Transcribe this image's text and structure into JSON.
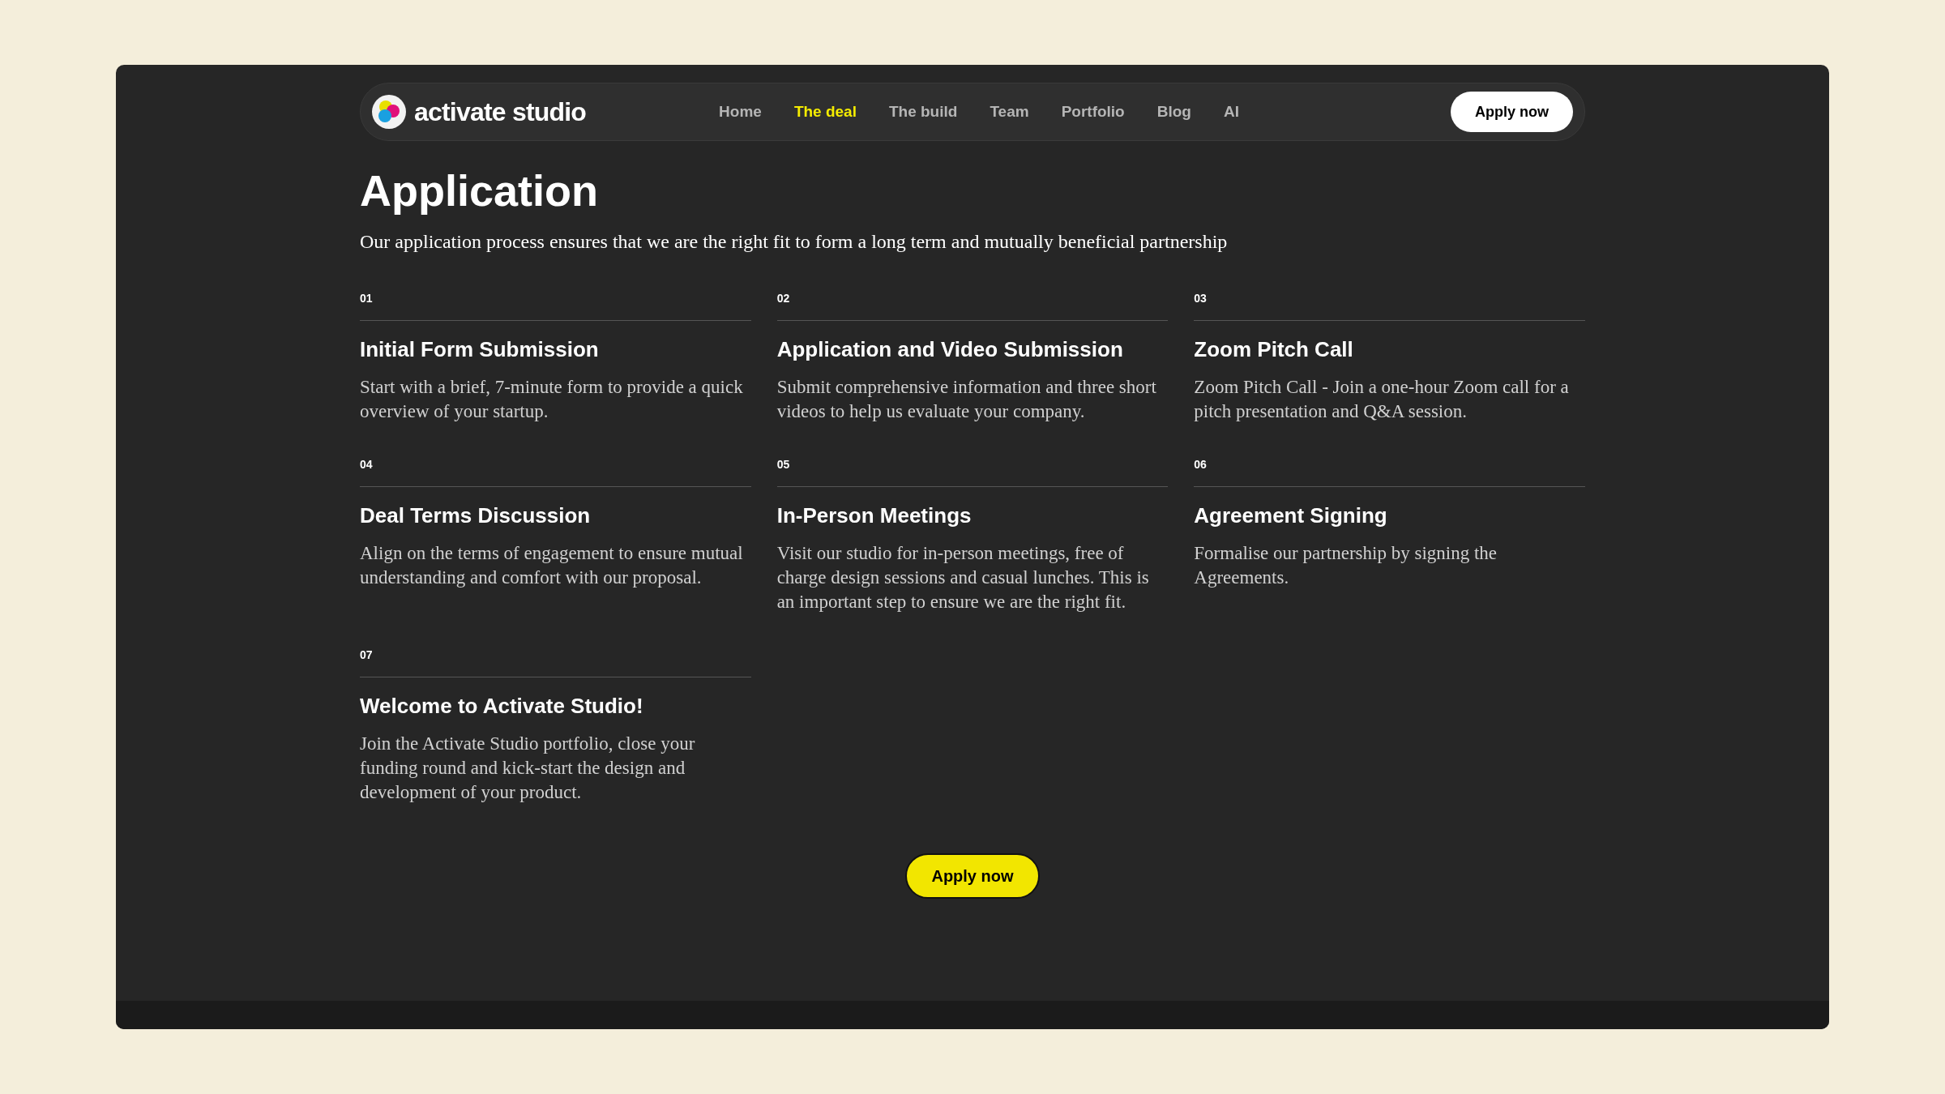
{
  "nav": {
    "logo": "activate studio",
    "links": [
      {
        "label": "Home",
        "selected": false
      },
      {
        "label": "The deal",
        "selected": true
      },
      {
        "label": "The build",
        "selected": false
      },
      {
        "label": "Team",
        "selected": false
      },
      {
        "label": "Portfolio",
        "selected": false
      },
      {
        "label": "Blog",
        "selected": false
      },
      {
        "label": "AI",
        "selected": false
      }
    ],
    "cta": "Apply now"
  },
  "heading": "Application",
  "intro": "Our application process ensures that we are the right fit to form a long term and mutually beneficial partnership",
  "steps": [
    {
      "number": "01",
      "title": "Initial Form Submission",
      "text": "Start with a brief, 7-minute form to provide a quick overview of your startup."
    },
    {
      "number": "02",
      "title": "Application and Video Submission",
      "text": "Submit comprehensive information and three short videos to help us evaluate your company."
    },
    {
      "number": "03",
      "title": "Zoom Pitch Call",
      "text": "Zoom Pitch Call - Join a one-hour Zoom call for a pitch presentation and Q&A session."
    },
    {
      "number": "04",
      "title": "Deal Terms Discussion",
      "text": "Align on the terms of engagement to ensure mutual understanding and comfort with our proposal."
    },
    {
      "number": "05",
      "title": "In-Person Meetings",
      "text": "Visit our studio for in-person meetings, free of charge design sessions and casual lunches. This is an important step to ensure we are the right fit."
    },
    {
      "number": "06",
      "title": "Agreement Signing",
      "text": "Formalise our partnership by signing the Agreements."
    },
    {
      "number": "07",
      "title": "Welcome to Activate Studio!",
      "text": "Join the Activate Studio portfolio, close your funding round and kick-start the design and development of your product."
    }
  ],
  "cta": "Apply now"
}
